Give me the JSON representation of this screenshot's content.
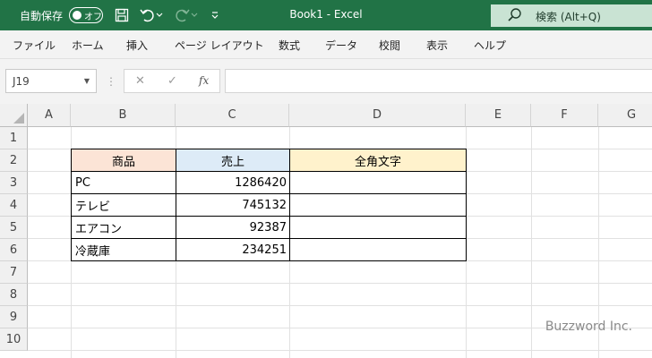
{
  "titlebar": {
    "autosave_label": "自動保存",
    "toggle_label": "オフ",
    "doc_title": "Book1  -  Excel",
    "search_text": "検索 (Alt+Q)"
  },
  "ribbon_tabs": [
    "ファイル",
    "ホーム",
    "挿入",
    "ページ レイアウト",
    "数式",
    "データ",
    "校閲",
    "表示",
    "ヘルプ"
  ],
  "formula_bar": {
    "name_box": "J19",
    "cancel_symbol": "✕",
    "enter_symbol": "✓",
    "fx_symbol": "fx",
    "formula": ""
  },
  "columns": [
    "A",
    "B",
    "C",
    "D",
    "E",
    "F",
    "G"
  ],
  "rows": [
    "1",
    "2",
    "3",
    "4",
    "5",
    "6",
    "7",
    "8",
    "9",
    "10"
  ],
  "table": {
    "headers": [
      "商品",
      "売上",
      "全角文字"
    ],
    "header_colors": [
      "#fce4d6",
      "#ddebf7",
      "#fff2cc"
    ],
    "rows": [
      {
        "product": "PC",
        "sales": "1286420",
        "fullwidth": ""
      },
      {
        "product": "テレビ",
        "sales": "745132",
        "fullwidth": ""
      },
      {
        "product": "エアコン",
        "sales": "92387",
        "fullwidth": ""
      },
      {
        "product": "冷蔵庫",
        "sales": "234251",
        "fullwidth": ""
      }
    ]
  },
  "watermark": "Buzzword Inc.",
  "colors": {
    "title_bar": "#217346",
    "search_box": "#c9e3d3"
  }
}
